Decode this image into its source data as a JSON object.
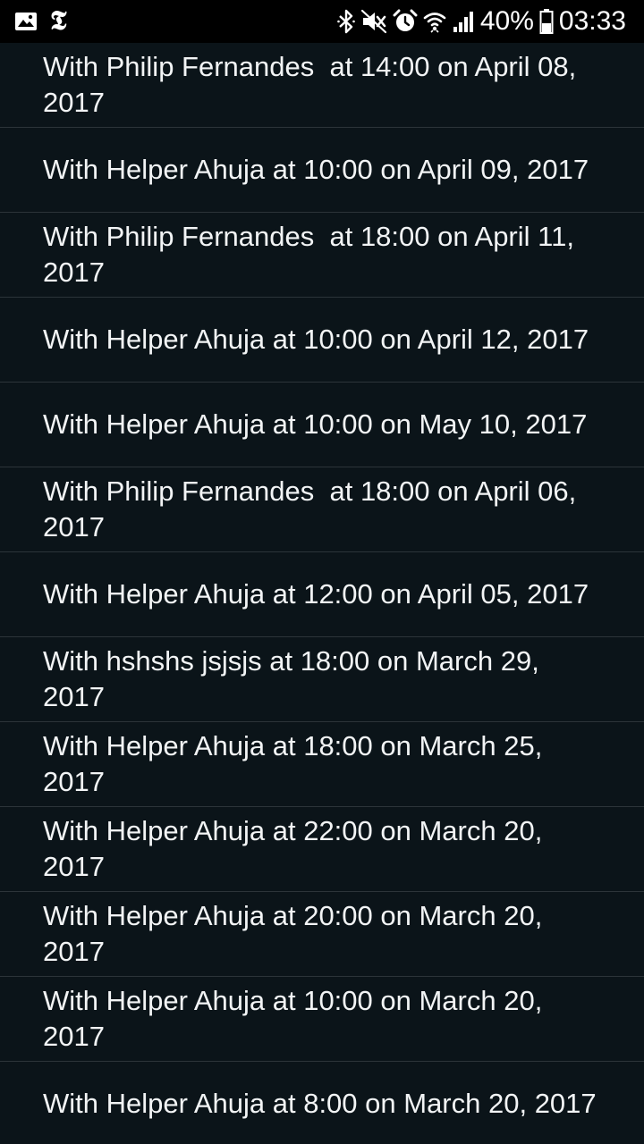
{
  "status_bar": {
    "left_icons": [
      "gallery-icon",
      "nyt-icon"
    ],
    "nyt_glyph": "𝕿",
    "right_icons": [
      "bluetooth-icon",
      "mute-icon",
      "alarm-icon",
      "wifi-icon",
      "signal-icon",
      "battery-icon"
    ],
    "battery_percent": "40%",
    "time": "03:33"
  },
  "appointments": [
    {
      "text": "With Philip Fernandes  at 14:00 on April 08, 2017"
    },
    {
      "text": "With Helper Ahuja at 10:00 on April 09, 2017"
    },
    {
      "text": "With Philip Fernandes  at 18:00 on April 11, 2017"
    },
    {
      "text": "With Helper Ahuja at 10:00 on April 12, 2017"
    },
    {
      "text": "With Helper Ahuja at 10:00 on May 10, 2017"
    },
    {
      "text": "With Philip Fernandes  at 18:00 on April 06, 2017"
    },
    {
      "text": "With Helper Ahuja at 12:00 on April 05, 2017"
    },
    {
      "text": "With hshshs jsjsjs at 18:00 on March 29, 2017"
    },
    {
      "text": "With Helper Ahuja at 18:00 on March 25, 2017"
    },
    {
      "text": "With Helper Ahuja at 22:00 on March 20, 2017"
    },
    {
      "text": "With Helper Ahuja at 20:00 on March 20, 2017"
    },
    {
      "text": "With Helper Ahuja at 10:00 on March 20, 2017"
    },
    {
      "text": "With Helper Ahuja at 8:00 on March 20, 2017"
    }
  ],
  "colors": {
    "background": "#0b1419",
    "status_bar": "#000000",
    "divider": "#2c3439",
    "text": "#f2f4f5"
  }
}
